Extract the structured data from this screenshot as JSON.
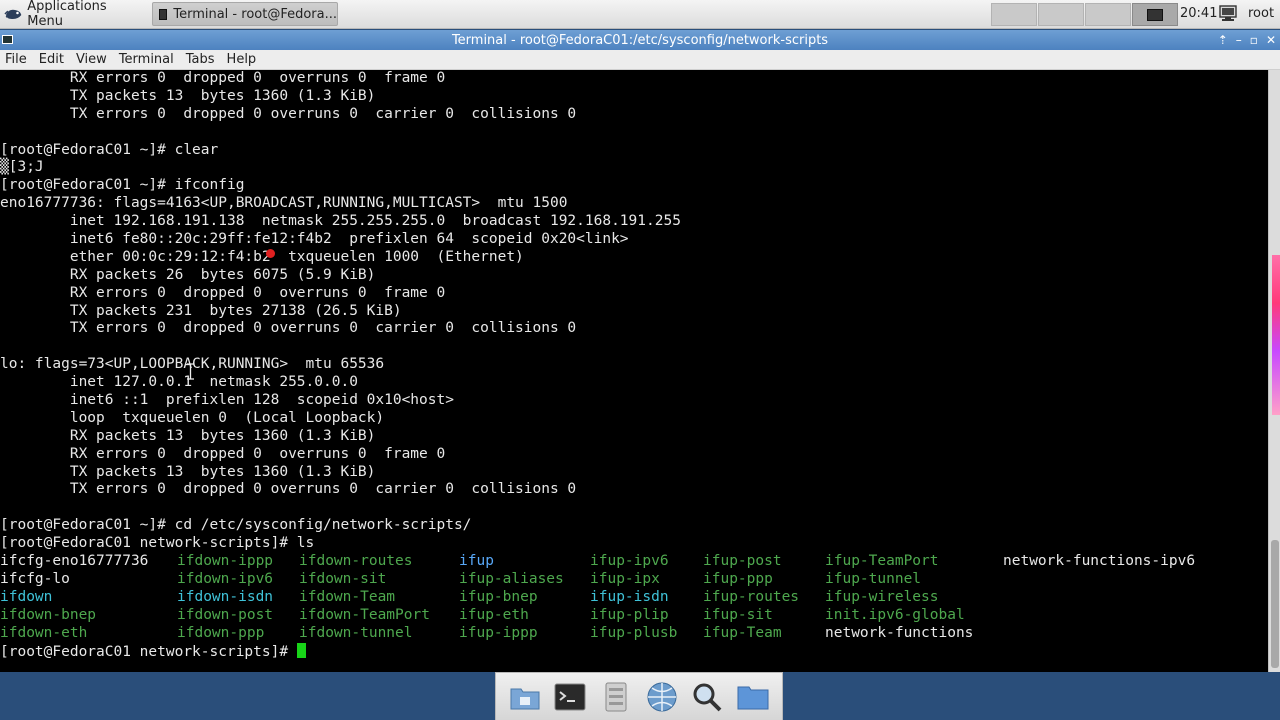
{
  "panel": {
    "apps_menu_label": "Applications Menu",
    "task_label": "Terminal - root@Fedora...",
    "clock": "20:41",
    "user": "root"
  },
  "window": {
    "title": "Terminal - root@FedoraC01:/etc/sysconfig/network-scripts",
    "controls": [
      "⇡",
      "–",
      "▫",
      "✕"
    ]
  },
  "menubar": [
    "File",
    "Edit",
    "View",
    "Terminal",
    "Tabs",
    "Help"
  ],
  "terminal": {
    "lines": [
      "        RX errors 0  dropped 0  overruns 0  frame 0",
      "        TX packets 13  bytes 1360 (1.3 KiB)",
      "        TX errors 0  dropped 0 overruns 0  carrier 0  collisions 0",
      "",
      "[root@FedoraC01 ~]# clear",
      "▒[3;J",
      "[root@FedoraC01 ~]# ifconfig",
      "eno16777736: flags=4163<UP,BROADCAST,RUNNING,MULTICAST>  mtu 1500",
      "        inet 192.168.191.138  netmask 255.255.255.0  broadcast 192.168.191.255",
      "        inet6 fe80::20c:29ff:fe12:f4b2  prefixlen 64  scopeid 0x20<link>",
      "        ether 00:0c:29:12:f4:b2  txqueuelen 1000  (Ethernet)",
      "        RX packets 26  bytes 6075 (5.9 KiB)",
      "        RX errors 0  dropped 0  overruns 0  frame 0",
      "        TX packets 231  bytes 27138 (26.5 KiB)",
      "        TX errors 0  dropped 0 overruns 0  carrier 0  collisions 0",
      "",
      "lo: flags=73<UP,LOOPBACK,RUNNING>  mtu 65536",
      "        inet 127.0.0.1  netmask 255.0.0.0",
      "        inet6 ::1  prefixlen 128  scopeid 0x10<host>",
      "        loop  txqueuelen 0  (Local Loopback)",
      "        RX packets 13  bytes 1360 (1.3 KiB)",
      "        RX errors 0  dropped 0  overruns 0  frame 0",
      "        TX packets 13  bytes 1360 (1.3 KiB)",
      "        TX errors 0  dropped 0 overruns 0  carrier 0  collisions 0",
      "",
      "[root@FedoraC01 ~]# cd /etc/sysconfig/network-scripts/",
      "[root@FedoraC01 network-scripts]# ls"
    ],
    "ls_columns": [
      [
        {
          "name": "ifcfg-eno16777736",
          "kind": "white"
        },
        {
          "name": "ifcfg-lo",
          "kind": "white"
        },
        {
          "name": "ifdown",
          "kind": "cyan"
        },
        {
          "name": "ifdown-bnep",
          "kind": "green"
        },
        {
          "name": "ifdown-eth",
          "kind": "green"
        }
      ],
      [
        {
          "name": "ifdown-ippp",
          "kind": "green"
        },
        {
          "name": "ifdown-ipv6",
          "kind": "green"
        },
        {
          "name": "ifdown-isdn",
          "kind": "cyan"
        },
        {
          "name": "ifdown-post",
          "kind": "green"
        },
        {
          "name": "ifdown-ppp",
          "kind": "green"
        }
      ],
      [
        {
          "name": "ifdown-routes",
          "kind": "green"
        },
        {
          "name": "ifdown-sit",
          "kind": "green"
        },
        {
          "name": "ifdown-Team",
          "kind": "green"
        },
        {
          "name": "ifdown-TeamPort",
          "kind": "green"
        },
        {
          "name": "ifdown-tunnel",
          "kind": "green"
        }
      ],
      [
        {
          "name": "ifup",
          "kind": "blue"
        },
        {
          "name": "ifup-aliases",
          "kind": "green"
        },
        {
          "name": "ifup-bnep",
          "kind": "green"
        },
        {
          "name": "ifup-eth",
          "kind": "green"
        },
        {
          "name": "ifup-ippp",
          "kind": "green"
        }
      ],
      [
        {
          "name": "ifup-ipv6",
          "kind": "green"
        },
        {
          "name": "ifup-ipx",
          "kind": "green"
        },
        {
          "name": "ifup-isdn",
          "kind": "cyan"
        },
        {
          "name": "ifup-plip",
          "kind": "green"
        },
        {
          "name": "ifup-plusb",
          "kind": "green"
        }
      ],
      [
        {
          "name": "ifup-post",
          "kind": "green"
        },
        {
          "name": "ifup-ppp",
          "kind": "green"
        },
        {
          "name": "ifup-routes",
          "kind": "green"
        },
        {
          "name": "ifup-sit",
          "kind": "green"
        },
        {
          "name": "ifup-Team",
          "kind": "green"
        }
      ],
      [
        {
          "name": "ifup-TeamPort",
          "kind": "green"
        },
        {
          "name": "ifup-tunnel",
          "kind": "green"
        },
        {
          "name": "ifup-wireless",
          "kind": "green"
        },
        {
          "name": "init.ipv6-global",
          "kind": "green"
        },
        {
          "name": "network-functions",
          "kind": "white"
        }
      ],
      [
        {
          "name": "network-functions-ipv6",
          "kind": "white"
        }
      ]
    ],
    "prompt": "[root@FedoraC01 network-scripts]# "
  },
  "dock": [
    "home-folder-icon",
    "terminal-icon",
    "file-manager-icon",
    "web-browser-icon",
    "search-icon",
    "folder-icon"
  ],
  "colors": {
    "title_bar": "#5a8fcb",
    "dir_color": "#58a8f8",
    "exec_color": "#4ea84e",
    "link_color": "#3fc2d8",
    "cursor": "#18d418"
  }
}
